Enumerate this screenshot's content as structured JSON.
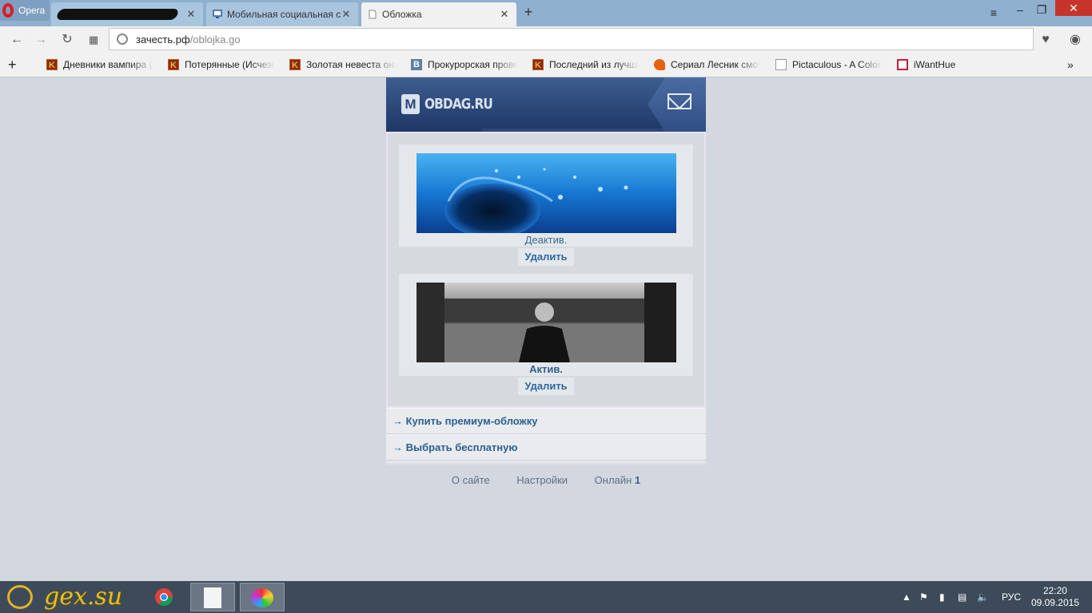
{
  "browser": {
    "menu_label": "Opera",
    "tabs": [
      {
        "title": "",
        "redacted": true
      },
      {
        "title": "Мобильная социальная с"
      },
      {
        "title": "Обложка"
      }
    ],
    "address": {
      "host": "зачесть.рф",
      "path": "/oblojka.go"
    },
    "bookmarks": [
      {
        "label": "Дневники вампира (",
        "icon": "k-icon"
      },
      {
        "label": "Потерянные (Исчезн",
        "icon": "k-icon"
      },
      {
        "label": "Золотая невеста онл",
        "icon": "k-icon"
      },
      {
        "label": "Прокурорская прове",
        "icon": "vk-icon"
      },
      {
        "label": "Последний из лучши",
        "icon": "k-icon"
      },
      {
        "label": "Сериал Лесник смот",
        "icon": "fox-icon"
      },
      {
        "label": "Pictaculous - A Color",
        "icon": "doc-icon"
      },
      {
        "label": "iWantHue",
        "icon": "hue-icon"
      }
    ]
  },
  "site": {
    "logo_letter": "M",
    "logo_text": "OBDAG.RU",
    "covers": [
      {
        "status": "Деактив.",
        "delete_label": "Удалить",
        "active": false
      },
      {
        "status": "Актив.",
        "delete_label": "Удалить",
        "active": true
      }
    ],
    "menu": [
      {
        "label": "→ Купить премиум-обложку"
      },
      {
        "label": "→ Выбрать бесплатную"
      }
    ],
    "footer": {
      "about": "О сайте",
      "settings": "Настройки",
      "online_label": "Онлайн",
      "online_count": "1"
    }
  },
  "taskbar": {
    "logo_text": "gex.su",
    "lang": "РУС",
    "time": "22:20",
    "date": "09.09.2015"
  }
}
